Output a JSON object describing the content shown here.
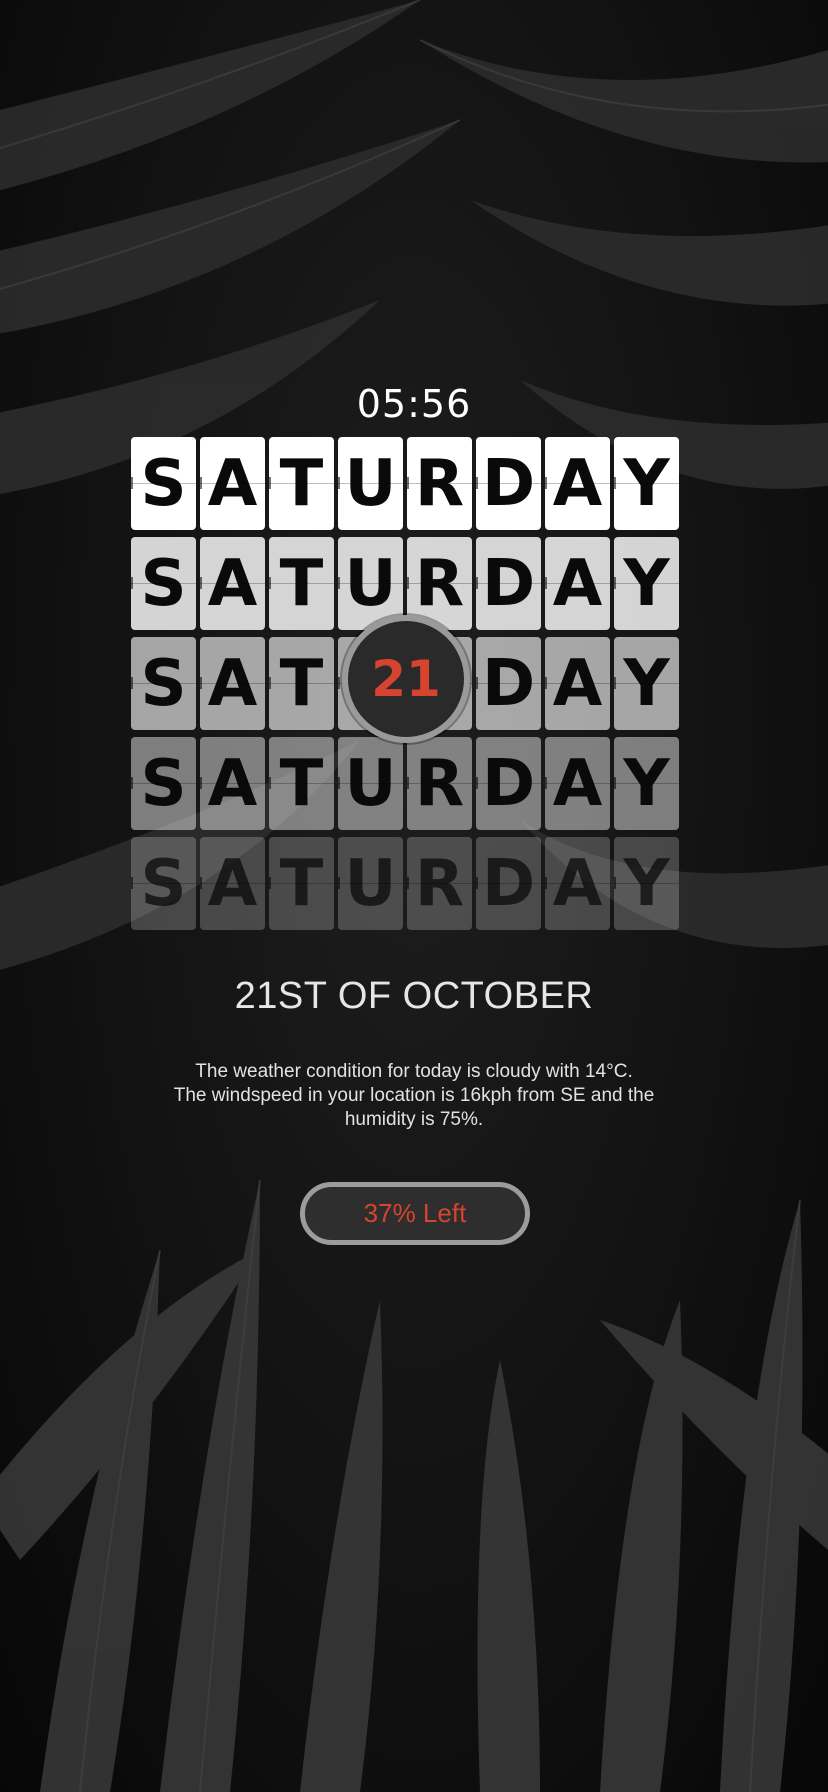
{
  "lockscreen": {
    "time": "05:56",
    "day_rows": [
      "SATURDAY",
      "SATURDAY",
      "SATURDAY",
      "SATURDAY",
      "SATURDAY"
    ],
    "date_number": "21",
    "full_date": "21ST OF OCTOBER",
    "weather_line1": "The weather condition for today is cloudy with 14°C.",
    "weather_line2": "The windspeed in your location is 16kph from SE and the",
    "weather_line3": "humidity is 75%.",
    "battery_label": "37% Left",
    "battery_level_percent": 37
  },
  "colors": {
    "accent": "#d6432f",
    "background": "#121212",
    "tile": "#ffffff"
  },
  "icons": {
    "wallpaper": "palm-leaves-background"
  }
}
